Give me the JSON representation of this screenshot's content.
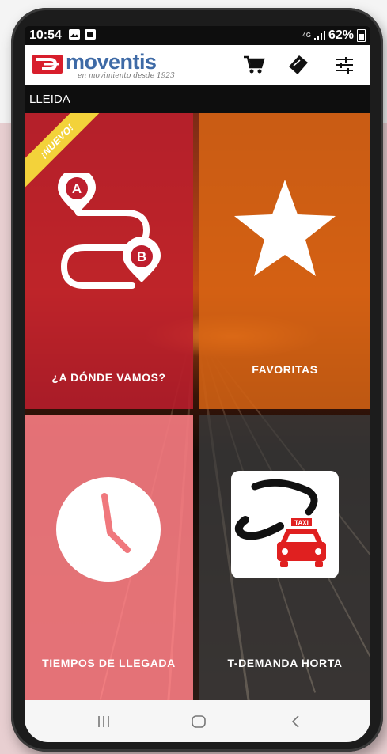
{
  "status_bar": {
    "time": "10:54",
    "network": "4G",
    "battery": "62%"
  },
  "header": {
    "brand": "moventis",
    "tagline": "en movimiento desde 1923"
  },
  "city": "LLEIDA",
  "tiles": [
    {
      "label": "¿A DÓNDE VAMOS?",
      "badge": "¡NUEVO!",
      "color": "#be1e2d"
    },
    {
      "label": "FAVORITAS",
      "color": "#d66414"
    },
    {
      "label": "TIEMPOS DE LLEGADA",
      "color": "#f0787d"
    },
    {
      "label": "T-DEMANDA HORTA",
      "color": "#3c3c3c"
    }
  ],
  "route_markers": {
    "start": "A",
    "end": "B"
  },
  "taxi_sign": "TAXI",
  "colors": {
    "brand_blue": "#3e6aa6",
    "brand_red": "#d81e2c",
    "badge_yellow": "#f3d23a"
  },
  "icons": {
    "cart": "shopping-cart-icon",
    "ticket": "ticket-icon",
    "settings": "sliders-icon"
  }
}
